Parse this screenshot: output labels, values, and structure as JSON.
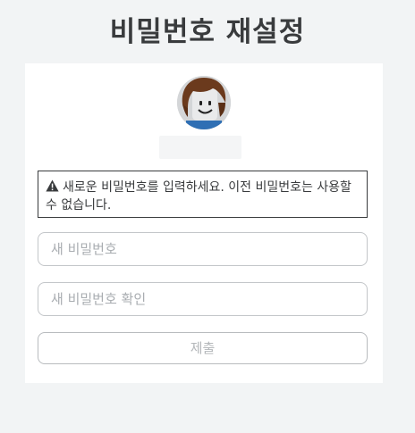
{
  "page": {
    "title": "비밀번호 재설정"
  },
  "alert": {
    "icon": "warning-icon",
    "message": "새로운 비밀번호를 입력하세요. 이전 비밀번호는 사용할 수 없습니다."
  },
  "form": {
    "new_password": {
      "value": "",
      "placeholder": "새 비밀번호"
    },
    "confirm_password": {
      "value": "",
      "placeholder": "새 비밀번호 확인"
    },
    "submit_label": "제출"
  },
  "colors": {
    "background": "#f2f4f5",
    "card": "#ffffff",
    "text": "#393b3d",
    "placeholder": "#a9adb1",
    "border": "#c3c6c9"
  }
}
